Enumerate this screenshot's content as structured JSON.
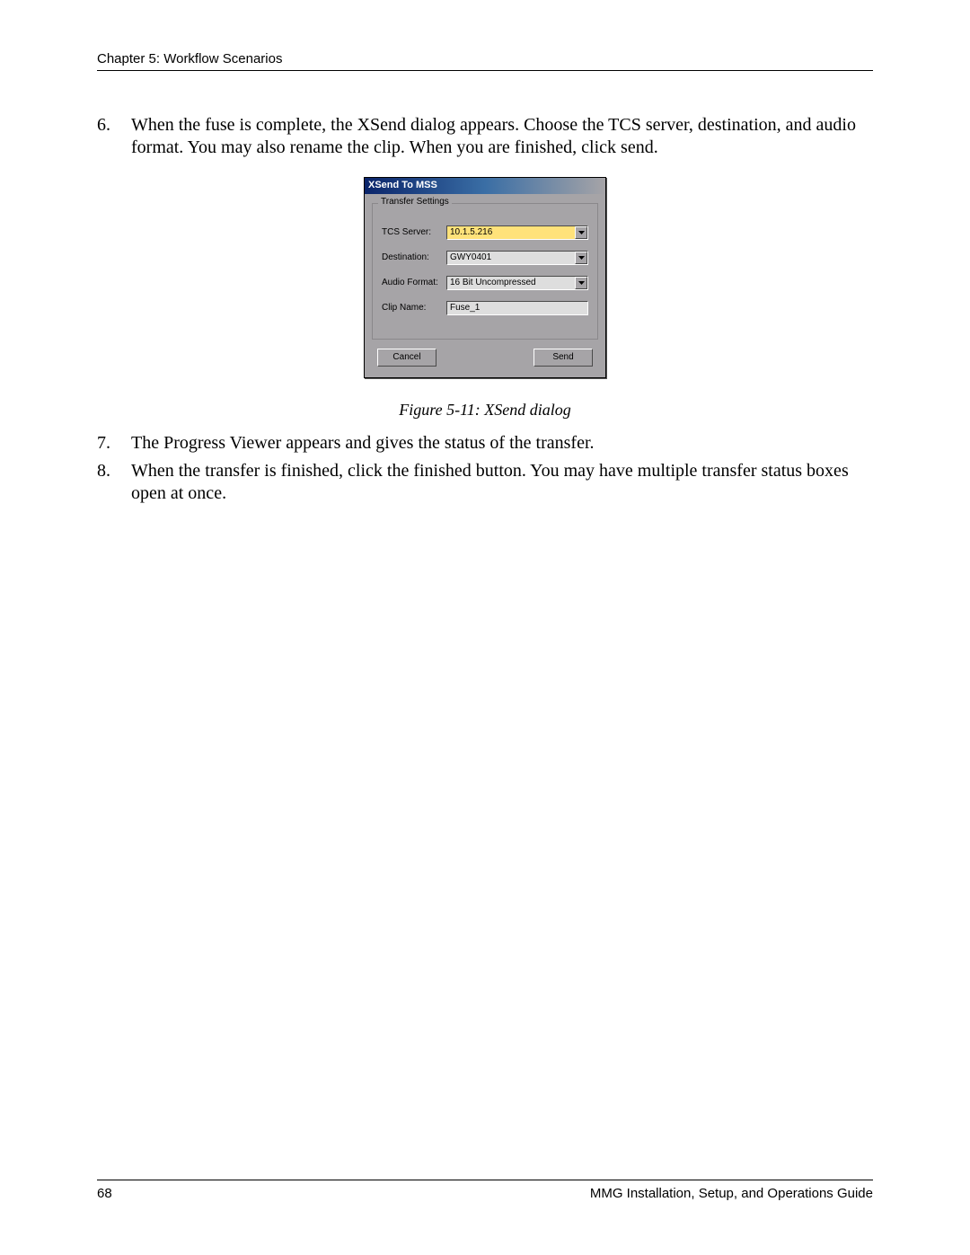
{
  "header": {
    "chapter": "Chapter 5: Workflow Scenarios"
  },
  "steps": {
    "6": {
      "num": "6.",
      "text": "When the fuse is complete, the XSend dialog appears. Choose the TCS server, destination, and audio format. You may also rename the clip. When you are finished, click send."
    },
    "7": {
      "num": "7.",
      "text": "The Progress Viewer appears and gives the status of the transfer."
    },
    "8": {
      "num": "8.",
      "text": "When the transfer is finished, click the finished button. You may have multiple transfer status boxes open at once."
    }
  },
  "dialog": {
    "title": "XSend To MSS",
    "legend": "Transfer Settings",
    "fields": {
      "tcs": {
        "label": "TCS Server:",
        "value": "10.1.5.216"
      },
      "dest": {
        "label": "Destination:",
        "value": "GWY0401"
      },
      "audio": {
        "label": "Audio Format:",
        "value": "16 Bit Uncompressed"
      },
      "clip": {
        "label": "Clip Name:",
        "value": "Fuse_1"
      }
    },
    "buttons": {
      "cancel": "Cancel",
      "send": "Send"
    }
  },
  "figure_caption": "Figure 5-11: XSend dialog",
  "footer": {
    "page": "68",
    "guide": "MMG Installation, Setup, and Operations Guide"
  }
}
